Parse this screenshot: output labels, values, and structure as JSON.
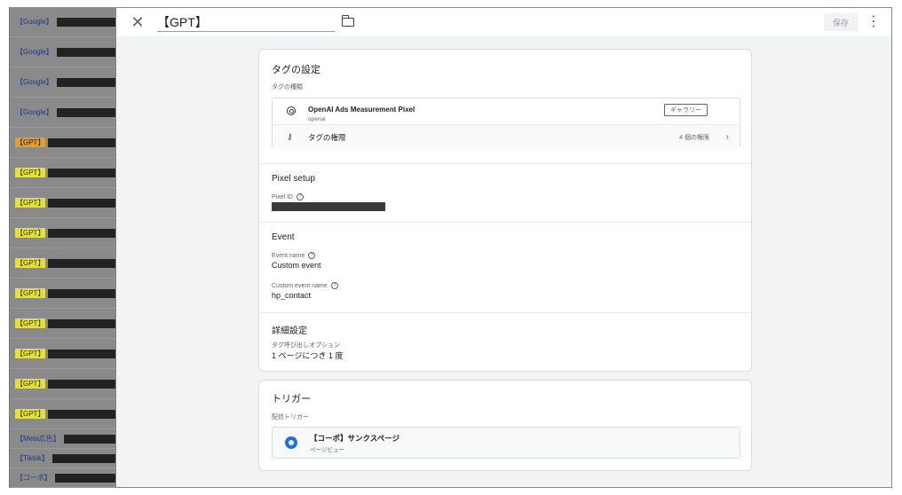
{
  "background_list": [
    {
      "tag": "【Google】",
      "style": "plain"
    },
    {
      "tag": "【Google】",
      "style": "plain"
    },
    {
      "tag": "【Google】",
      "style": "plain"
    },
    {
      "tag": "【Google】",
      "style": "plain"
    },
    {
      "tag": "【GPT】",
      "style": "gpt-orange"
    },
    {
      "tag": "【GPT】",
      "style": "gpt"
    },
    {
      "tag": "【GPT】",
      "style": "gpt"
    },
    {
      "tag": "【GPT】",
      "style": "gpt"
    },
    {
      "tag": "【GPT】",
      "style": "gpt"
    },
    {
      "tag": "【GPT】",
      "style": "gpt"
    },
    {
      "tag": "【GPT】",
      "style": "gpt"
    },
    {
      "tag": "【GPT】",
      "style": "gpt"
    },
    {
      "tag": "【GPT】",
      "style": "gpt"
    },
    {
      "tag": "【GPT】",
      "style": "gpt"
    },
    {
      "tag": "【Meta広告】",
      "style": "plain"
    },
    {
      "tag": "【Tiktok】",
      "style": "plain"
    },
    {
      "tag": "【コーポ】",
      "style": "plain"
    }
  ],
  "topbar": {
    "close_icon": "close-icon",
    "title": "【GPT】",
    "folder_icon": "folder-icon",
    "save_label": "保存",
    "more_icon": "more-vert-icon"
  },
  "tag_config": {
    "title": "タグの設定",
    "type_label": "タグの種類",
    "tag_type": {
      "name": "OpenAI Ads Measurement Pixel",
      "vendor": "openai",
      "gallery_label": "ギャラリー"
    },
    "permissions": {
      "label": "タグの権限",
      "count": "4 個の権限"
    },
    "pixel_setup": {
      "title": "Pixel setup",
      "pixel_id_label": "Pixel ID"
    },
    "event": {
      "title": "Event",
      "event_name_label": "Event name",
      "event_name_value": "Custom event",
      "custom_event_label": "Custom event name",
      "custom_event_value": "hp_contact"
    },
    "advanced": {
      "title": "詳細設定",
      "firing_option_label": "タグ呼び出しオプション",
      "firing_option_value": "1 ページにつき 1 度"
    }
  },
  "trigger": {
    "title": "トリガー",
    "firing_label": "配信トリガー",
    "name": "【コーポ】サンクスページ",
    "type": "ページビュー"
  },
  "colors": {
    "accent": "#1a73e8",
    "gpt_highlight": "#e6e12a",
    "gpt_active": "#e69b2a"
  }
}
